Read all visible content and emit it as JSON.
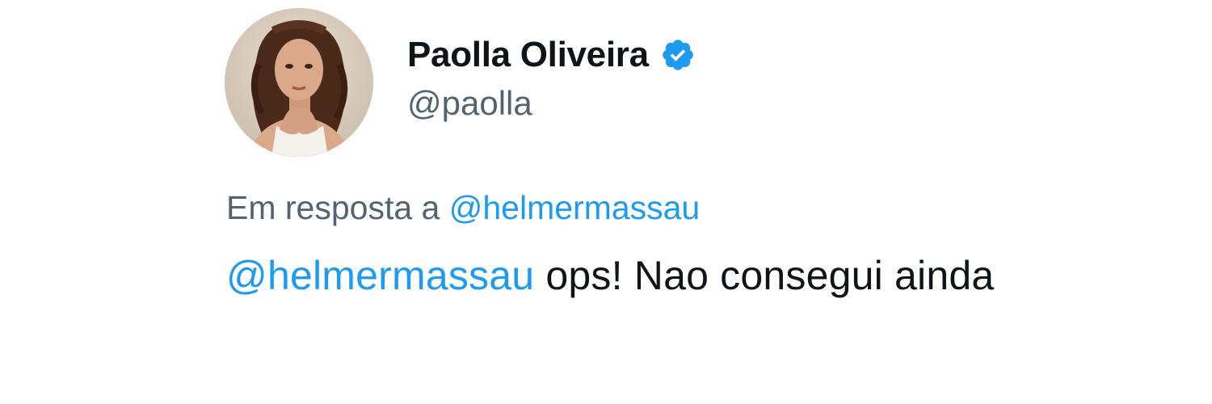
{
  "user": {
    "display_name": "Paolla Oliveira",
    "handle": "@paolla",
    "verified_icon": "verified-badge-icon",
    "verified_color": "#1d9bf0"
  },
  "reply": {
    "prefix": "Em resposta a ",
    "mention": "@helmermassau"
  },
  "tweet": {
    "mention": "@helmermassau",
    "text": " ops! Nao consegui ainda"
  },
  "colors": {
    "text_primary": "#0f1419",
    "text_secondary": "#536471",
    "link": "#1d9bf0"
  }
}
